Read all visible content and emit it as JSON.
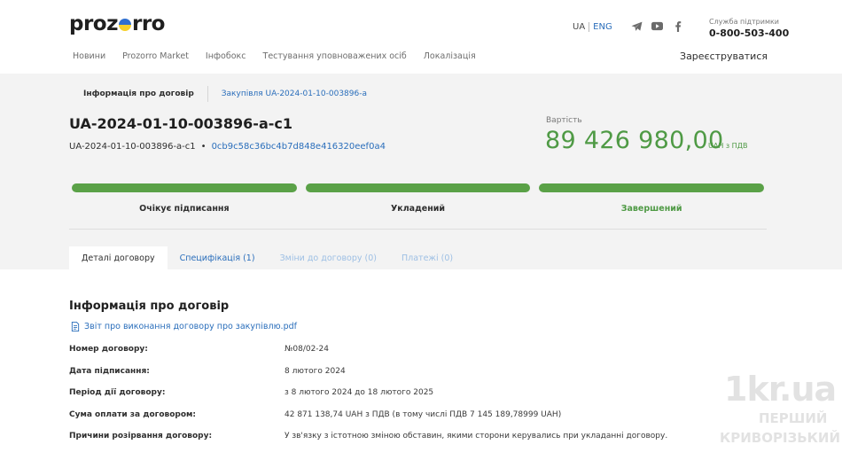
{
  "header": {
    "logo_left": "proz",
    "logo_right": "rro",
    "lang_active": "UA",
    "lang_other": "ENG",
    "social_icons": [
      "telegram-icon",
      "youtube-icon",
      "facebook-icon"
    ],
    "support_label": "Служба підтримки",
    "support_phone": "0-800-503-400",
    "nav": [
      "Новини",
      "Prozorro Market",
      "Інфобокс",
      "Тестування уповноважених осіб",
      "Локалізація"
    ],
    "register": "Зареєструватися"
  },
  "breadcrumb": {
    "current": "Інформація про договір",
    "link": "Закупівля UA-2024-01-10-003896-a"
  },
  "contract": {
    "title": "UA-2024-01-10-003896-a-c1",
    "id": "UA-2024-01-10-003896-a-c1",
    "separator": "•",
    "hash": "0cb9c58c36bc4b7d848e416320eef0a4",
    "value_label": "Вартість",
    "value_amount": "89 426 980,00",
    "value_currency": "UAH з ПДВ"
  },
  "status_steps": [
    {
      "label": "Очікує підписання",
      "done": false
    },
    {
      "label": "Укладений",
      "done": false
    },
    {
      "label": "Завершений",
      "done": true
    }
  ],
  "tabs": [
    {
      "label": "Деталі договору",
      "state": "active"
    },
    {
      "label": "Специфікація (1)",
      "state": "link"
    },
    {
      "label": "Зміни до договору (0)",
      "state": "muted"
    },
    {
      "label": "Платежі (0)",
      "state": "muted"
    }
  ],
  "details": {
    "title": "Інформація про договір",
    "document": "Звіт про виконання договору про закупівлю.pdf",
    "rows": [
      {
        "key": "Номер договору:",
        "value": "№08/02-24"
      },
      {
        "key": "Дата підписання:",
        "value": "8 лютого 2024"
      },
      {
        "key": "Період дії договору:",
        "value": "з 8 лютого 2024 до 18 лютого 2025"
      },
      {
        "key": "Сума оплати за договором:",
        "value": "42 871 138,74 UAH з ПДВ (в тому числі ПДВ 7 145 189,78999 UAH)"
      },
      {
        "key": "Причини розірвання договору:",
        "value": "У зв'язку з істотною зміною обставин, якими сторони керувались при укладанні договору."
      }
    ]
  },
  "watermark": {
    "big": "1kr.ua",
    "line1": "ПЕРШИЙ",
    "line2": "КРИВОРІЗЬКИЙ"
  },
  "colors": {
    "accent_green": "#5aa147",
    "link_blue": "#2a6ebb",
    "band_bg": "#f3f3f3"
  }
}
